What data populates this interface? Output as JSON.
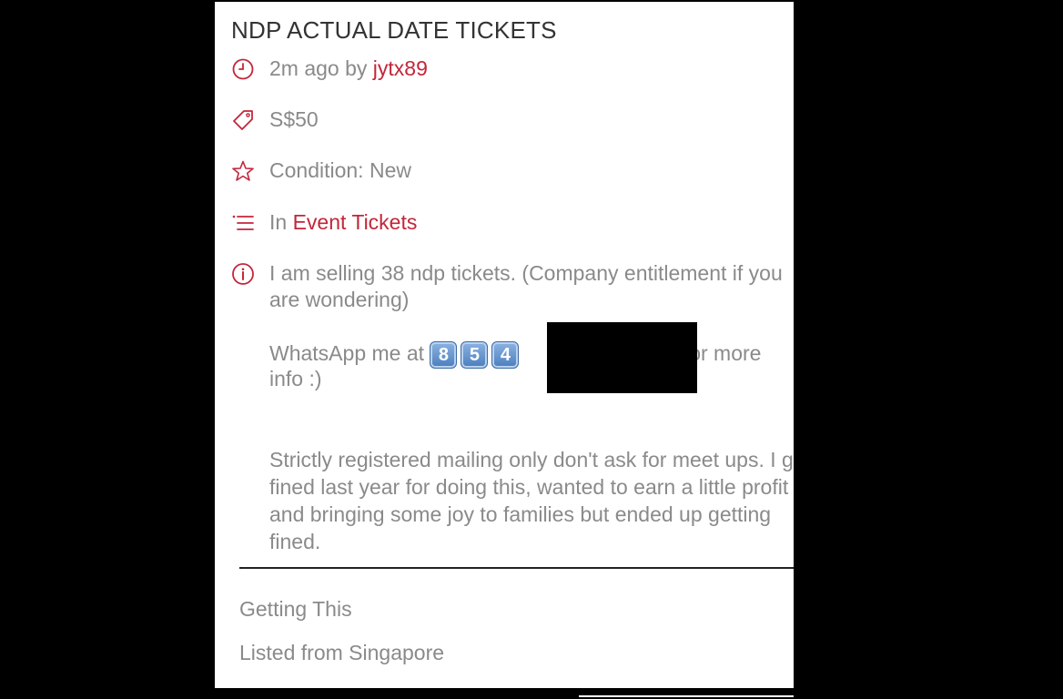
{
  "listing": {
    "title": "NDP ACTUAL DATE TICKETS",
    "time_ago": "2m ago by ",
    "username": "jytx89",
    "price": "S$50",
    "condition": "Condition: New",
    "category_prefix": "In ",
    "category": "Event Tickets",
    "description": {
      "line1": "I am selling 38 ndp tickets. (Company entitlement if you are wondering)",
      "whatsapp_prefix": "WhatsApp me at ",
      "whatsapp_digits": [
        "8",
        "5",
        "4"
      ],
      "whatsapp_suffix": " for more",
      "whatsapp_suffix2": "info :)",
      "line3": "Strictly registered mailing only don't ask for meet ups. I got fined last year for doing this, wanted to earn a little profit and bringing some joy to families but ended up getting fined."
    }
  },
  "getting_this": {
    "heading": "Getting This",
    "location": "Listed from Singapore"
  },
  "icons": {
    "accent_color": "#c3263a",
    "time": "clock-icon",
    "price": "tag-icon",
    "condition": "star-icon",
    "category": "list-icon",
    "description": "info-icon"
  }
}
